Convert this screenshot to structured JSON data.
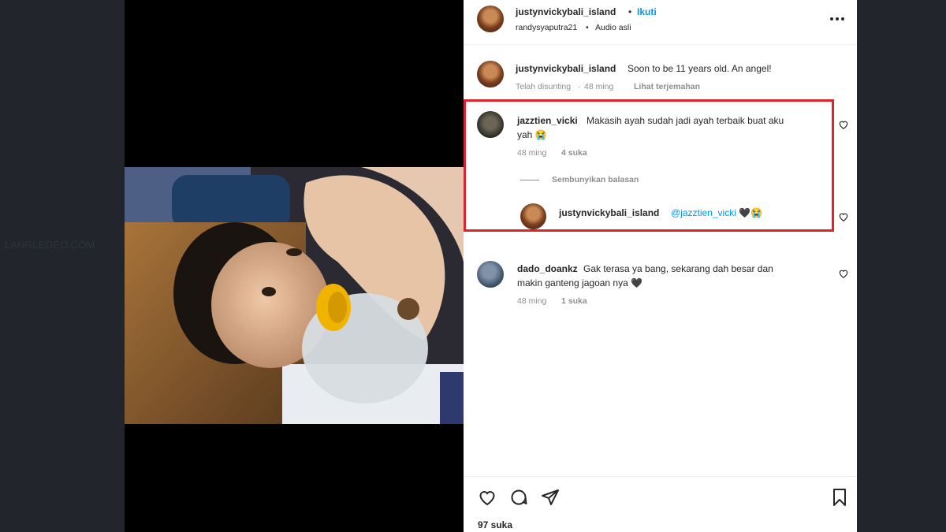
{
  "background": {
    "ghost_text": "LANGLEGEO.COM"
  },
  "post": {
    "owner": "justynvickybali_island",
    "follow_label": "Ikuti",
    "separator": "•",
    "audio_user": "randysyaputra21",
    "audio_label": "Audio asli",
    "more_icon": "more-horizontal-icon"
  },
  "caption": {
    "username": "justynvickybali_island",
    "text": "Soon to be 11 years old. An angel!",
    "edited": "Telah disunting",
    "time": "48 ming",
    "translate": "Lihat terjemahan"
  },
  "comments": [
    {
      "username": "jazztien_vicki",
      "text_line1": "Makasih ayah sudah jadi ayah terbaik buat aku",
      "text_line2": "yah 😭",
      "time": "48 ming",
      "likes": "4 suka",
      "hide_replies": "Sembunyikan balasan",
      "reply": {
        "username": "justynvickybali_island",
        "text": "@jazztien_vicki 🖤😭"
      }
    },
    {
      "username": "dado_doankz",
      "text_line1": "Gak terasa ya bang, sekarang dah besar dan",
      "text_line2": "makin ganteng jagoan nya 🖤",
      "time": "48 ming",
      "likes": "1 suka"
    }
  ],
  "actions": {
    "like_icon": "heart-icon",
    "comment_icon": "comment-icon",
    "share_icon": "send-icon",
    "save_icon": "bookmark-icon",
    "likes_count": "97 suka"
  },
  "colors": {
    "highlight_border": "#e0212e",
    "link": "#0095f6",
    "page_bg": "#1e2126"
  }
}
